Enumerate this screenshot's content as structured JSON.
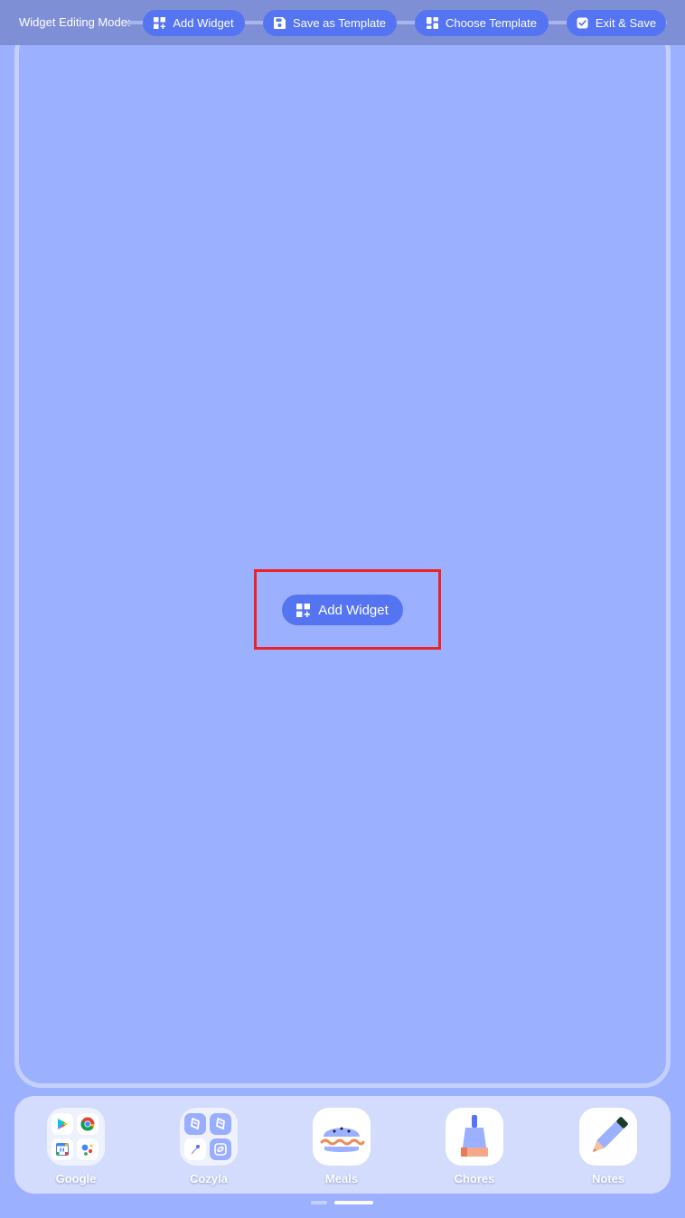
{
  "edit_bar": {
    "label": "Widget Editing Mode:",
    "buttons": [
      {
        "label": "Add Widget",
        "icon": "widget-add-icon"
      },
      {
        "label": "Save as Template",
        "icon": "floppy-disk-icon"
      },
      {
        "label": "Choose Template",
        "icon": "template-grid-icon"
      },
      {
        "label": "Exit & Save",
        "icon": "checkbox-icon"
      }
    ]
  },
  "center": {
    "add_widget_label": "Add Widget",
    "icon": "widget-add-icon"
  },
  "dock": {
    "apps": [
      {
        "label": "Google",
        "icon": "google-folder-icon"
      },
      {
        "label": "Cozyla",
        "icon": "cozyla-folder-icon"
      },
      {
        "label": "Meals",
        "icon": "burger-icon"
      },
      {
        "label": "Chores",
        "icon": "broom-icon"
      },
      {
        "label": "Notes",
        "icon": "pencil-icon"
      }
    ]
  },
  "colors": {
    "background": "#9bb0ff",
    "accent": "#5574f2",
    "highlight": "#ee2222",
    "dock": "#d4dcfd"
  }
}
